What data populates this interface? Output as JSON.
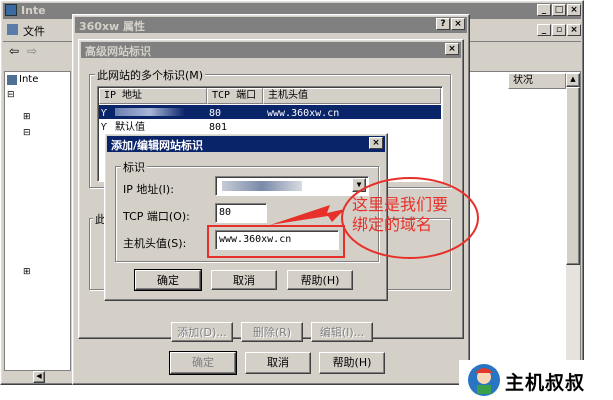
{
  "mmc": {
    "title": "Inte",
    "menu_file": "文件",
    "tree_root": "Inte",
    "status_col": "状况"
  },
  "props": {
    "title": "360xw 属性",
    "help_btn": "?",
    "close_btn": "×",
    "ok": "确定",
    "cancel": "取消",
    "help": "帮助(H)"
  },
  "adv": {
    "title": "高级网站标识",
    "close_btn": "×",
    "group_label": "此网站的多个标识(M)",
    "columns": [
      "IP 地址",
      "TCP 端口",
      "主机头值"
    ],
    "rows": [
      {
        "ip": "",
        "port": "80",
        "host": "www.360xw.cn"
      },
      {
        "ip": "默认值",
        "port": "801",
        "host": ""
      }
    ],
    "add": "添加(D)...",
    "remove": "删除(R)",
    "edit": "编辑(I)...",
    "group2_label": "此"
  },
  "edit_dialog": {
    "title": "添加/编辑网站标识",
    "close_btn": "×",
    "group_label": "标识",
    "ip_label": "IP 地址(I):",
    "ip_value": "",
    "port_label": "TCP 端口(O):",
    "port_value": "80",
    "host_label": "主机头值(S):",
    "host_value": "www.360xw.cn",
    "ok": "确定",
    "cancel": "取消",
    "help": "帮助(H)"
  },
  "annotation": {
    "line1": "这里是我们要",
    "line2": "绑定的域名",
    "color": "#e8302a"
  },
  "watermark": {
    "text": "主机叔叔"
  }
}
